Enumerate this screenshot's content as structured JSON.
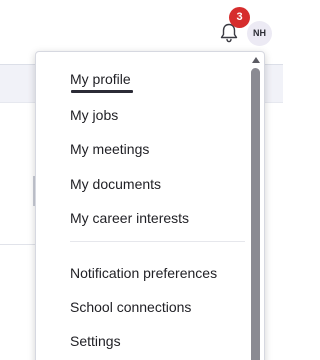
{
  "header": {
    "notifications": {
      "icon": "bell-icon",
      "count": "3",
      "badge_color": "#d62d2d"
    },
    "avatar": {
      "initials": "NH",
      "background": "#eceaf4"
    }
  },
  "menu": {
    "items": [
      {
        "label": "My profile",
        "active": true
      },
      {
        "label": "My jobs"
      },
      {
        "label": "My meetings"
      },
      {
        "label": "My documents"
      },
      {
        "label": "My career interests"
      }
    ],
    "secondary_items": [
      {
        "label": "Notification preferences"
      },
      {
        "label": "School connections"
      },
      {
        "label": "Settings"
      }
    ]
  },
  "colors": {
    "text": "#1f1f24",
    "active_underline": "#2b2b36",
    "scrollbar_thumb": "#8a8a92"
  }
}
